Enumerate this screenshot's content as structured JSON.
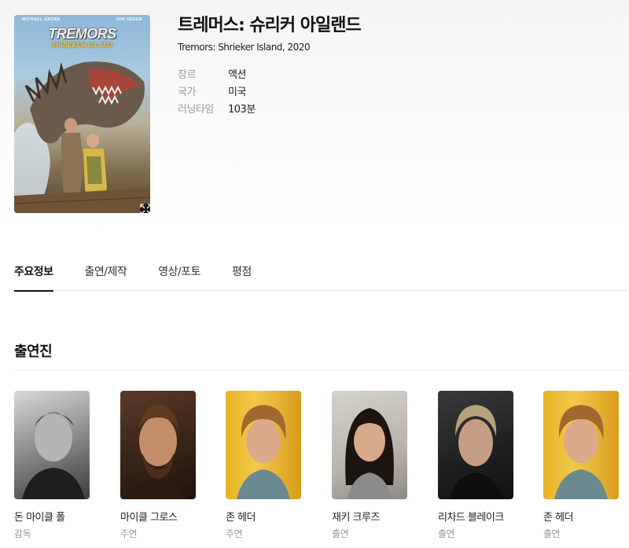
{
  "movie": {
    "title_ko": "트레머스: 슈리커 아일랜드",
    "title_en": "Tremors: Shrieker Island, 2020",
    "meta": [
      {
        "key": "장르",
        "value": "액션"
      },
      {
        "key": "국가",
        "value": "미국"
      },
      {
        "key": "러닝타임",
        "value": "103분"
      }
    ]
  },
  "poster": {
    "credit_left": "MICHAEL GROSS",
    "credit_right": "JON HEDER",
    "title": "TREMORS",
    "subtitle": "SHRIEKER ISLAND",
    "expand_icon": "expand-icon"
  },
  "tabs": [
    {
      "label": "주요정보",
      "active": true
    },
    {
      "label": "출연/제작",
      "active": false
    },
    {
      "label": "영상/포토",
      "active": false
    },
    {
      "label": "평점",
      "active": false
    }
  ],
  "cast_section": {
    "title": "출연진",
    "members": [
      {
        "name": "돈 마이클 폴",
        "role": "감독"
      },
      {
        "name": "마이클 그로스",
        "role": "주연"
      },
      {
        "name": "존 헤더",
        "role": "주연"
      },
      {
        "name": "재키 크루즈",
        "role": "출연"
      },
      {
        "name": "리차드 블레이크",
        "role": "출연"
      },
      {
        "name": "존 헤더",
        "role": "출연"
      }
    ]
  },
  "colors": {
    "active_tab_underline": "#111111",
    "muted_text": "#999999",
    "divider": "#e6e6e6"
  }
}
